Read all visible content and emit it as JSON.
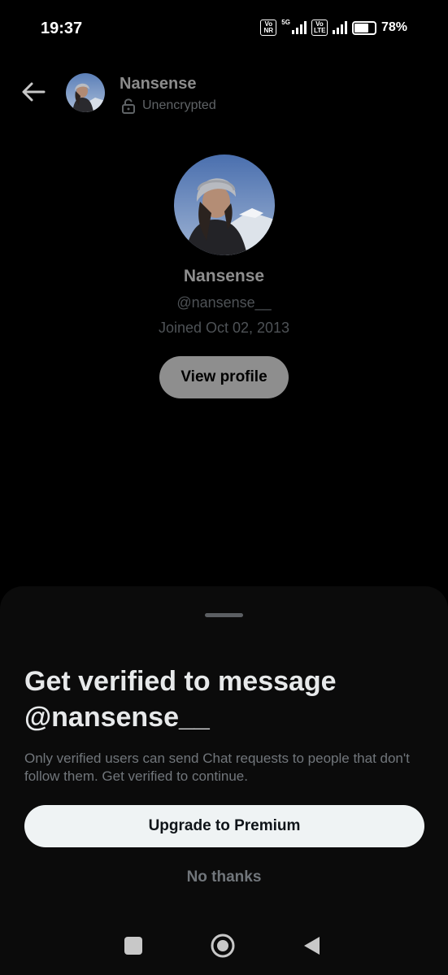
{
  "status_bar": {
    "time": "19:37",
    "network_5g": "5G",
    "volte_1_top": "Vo",
    "volte_1_bottom": "NR",
    "volte_2_top": "Vo",
    "volte_2_bottom": "LTE",
    "battery_percent": "78%",
    "battery_level": 0.78
  },
  "header": {
    "name": "Nansense",
    "encryption_status": "Unencrypted",
    "back_icon": "arrow-left-icon",
    "lock_icon": "unlock-icon"
  },
  "profile": {
    "name": "Nansense",
    "handle": "@nansense__",
    "joined": "Joined Oct 02, 2013",
    "view_profile_label": "View profile"
  },
  "sheet": {
    "title": "Get verified to message @nansense__",
    "description": "Only verified users can send Chat requests to people that don't follow them. Get verified to continue.",
    "primary_button": "Upgrade to Premium",
    "secondary_button": "No thanks"
  },
  "nav": {
    "recents_icon": "square-icon",
    "home_icon": "circle-home-icon",
    "back_icon": "triangle-back-icon"
  },
  "colors": {
    "background": "#000000",
    "sheet_background": "#0b0b0b",
    "primary_button_bg": "#eff3f4",
    "muted_text": "#71767b"
  }
}
